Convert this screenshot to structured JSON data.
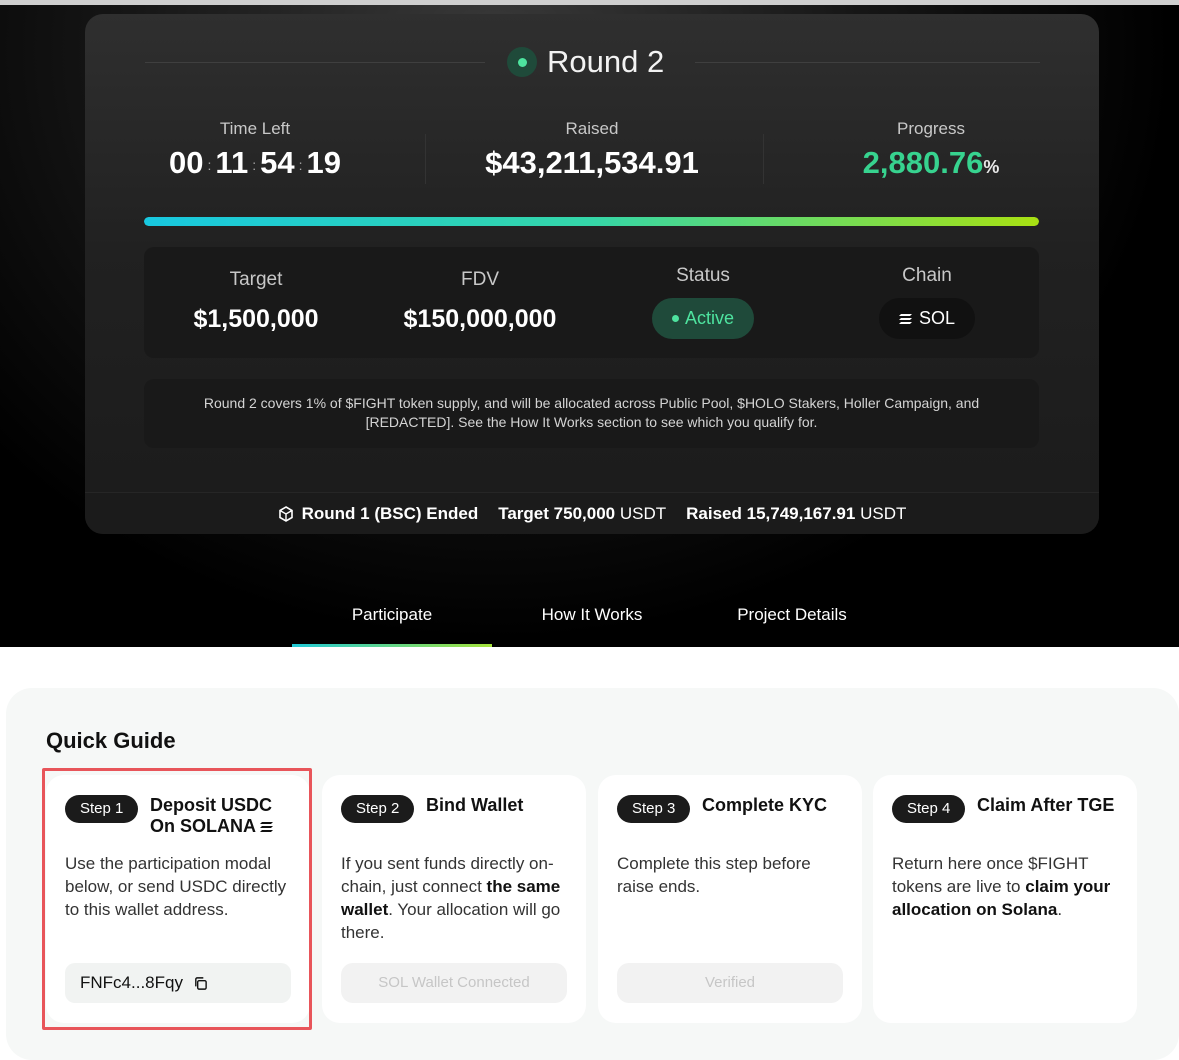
{
  "round": {
    "title": "Round 2"
  },
  "stats": {
    "time_left_label": "Time Left",
    "timer": [
      "00",
      "11",
      "54",
      "19"
    ],
    "raised_label": "Raised",
    "raised_value": "$43,211,534.91",
    "progress_label": "Progress",
    "progress_value": "2,880.76",
    "progress_unit": "%",
    "progress_bar_fraction": 1.0
  },
  "info": {
    "target_label": "Target",
    "target_value": "$1,500,000",
    "fdv_label": "FDV",
    "fdv_value": "$150,000,000",
    "status_label": "Status",
    "status_value": "Active",
    "chain_label": "Chain",
    "chain_value": "SOL"
  },
  "description": "Round 2 covers 1% of $FIGHT token supply, and will be allocated across Public Pool, $HOLO Stakers, Holler Campaign, and [REDACTED]. See the How It Works section to see which you qualify for.",
  "previous_round": {
    "label": "Round 1 (BSC) Ended",
    "target_label": "Target",
    "target_value": "750,000",
    "target_unit": "USDT",
    "raised_label": "Raised",
    "raised_value": "15,749,167.91",
    "raised_unit": "USDT"
  },
  "tabs": [
    "Participate",
    "How It Works",
    "Project Details"
  ],
  "active_tab": "Participate",
  "guide": {
    "title": "Quick Guide",
    "steps": [
      {
        "badge": "Step 1",
        "title": "Deposit USDC On SOLANA",
        "body": "Use the participation modal below, or send USDC directly to this wallet address.",
        "address": "FNFc4...8Fqy"
      },
      {
        "badge": "Step 2",
        "title": "Bind Wallet",
        "body_pre": "If you sent funds directly on-chain, just connect ",
        "body_bold": "the same wallet",
        "body_post": ". Your allocation will go there.",
        "button": "SOL Wallet Connected"
      },
      {
        "badge": "Step 3",
        "title": "Complete KYC",
        "body": "Complete this step before raise ends.",
        "button": "Verified"
      },
      {
        "badge": "Step 4",
        "title": "Claim After TGE",
        "body_pre": "Return here once $FIGHT tokens are live to ",
        "body_bold": "claim your allocation on Solana",
        "body_post": "."
      }
    ]
  },
  "colors": {
    "accent_green": "#37d38f",
    "highlight_red": "#e8555a",
    "progress_start": "#18c8e0",
    "progress_end": "#a8e012"
  }
}
